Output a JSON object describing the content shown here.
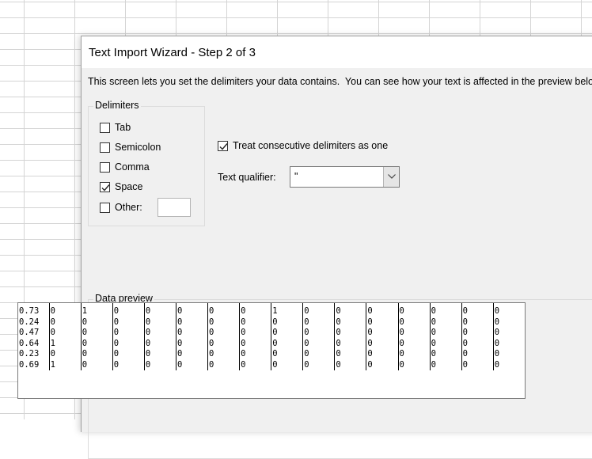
{
  "window": {
    "title": "Text Import Wizard - Step 2 of 3",
    "description": "This screen lets you set the delimiters your data contains.  You can see how your text is affected in the preview below."
  },
  "delimiters": {
    "group_label": "Delimiters",
    "items": [
      {
        "label": "Tab",
        "checked": false
      },
      {
        "label": "Semicolon",
        "checked": false
      },
      {
        "label": "Comma",
        "checked": false
      },
      {
        "label": "Space",
        "checked": true
      },
      {
        "label": "Other:",
        "checked": false
      }
    ],
    "other_value": ""
  },
  "consecutive": {
    "label": "Treat consecutive delimiters as one",
    "checked": true
  },
  "qualifier": {
    "label": "Text qualifier:",
    "value": "\""
  },
  "preview": {
    "group_label": "Data preview",
    "rows": [
      [
        "0.73",
        "0",
        "1",
        "0",
        "0",
        "0",
        "0",
        "0",
        "1",
        "0",
        "0",
        "0",
        "0",
        "0",
        "0",
        "0"
      ],
      [
        "0.24",
        "0",
        "0",
        "0",
        "0",
        "0",
        "0",
        "0",
        "0",
        "0",
        "0",
        "0",
        "0",
        "0",
        "0",
        "0"
      ],
      [
        "0.47",
        "0",
        "0",
        "0",
        "0",
        "0",
        "0",
        "0",
        "0",
        "0",
        "0",
        "0",
        "0",
        "0",
        "0",
        "0"
      ],
      [
        "0.64",
        "1",
        "0",
        "0",
        "0",
        "0",
        "0",
        "0",
        "0",
        "0",
        "0",
        "0",
        "0",
        "0",
        "0",
        "0"
      ],
      [
        "0.23",
        "0",
        "0",
        "0",
        "0",
        "0",
        "0",
        "0",
        "0",
        "0",
        "0",
        "0",
        "0",
        "0",
        "0",
        "0"
      ],
      [
        "0.69",
        "1",
        "0",
        "0",
        "0",
        "0",
        "0",
        "0",
        "0",
        "0",
        "0",
        "0",
        "0",
        "0",
        "0",
        "0"
      ]
    ]
  }
}
